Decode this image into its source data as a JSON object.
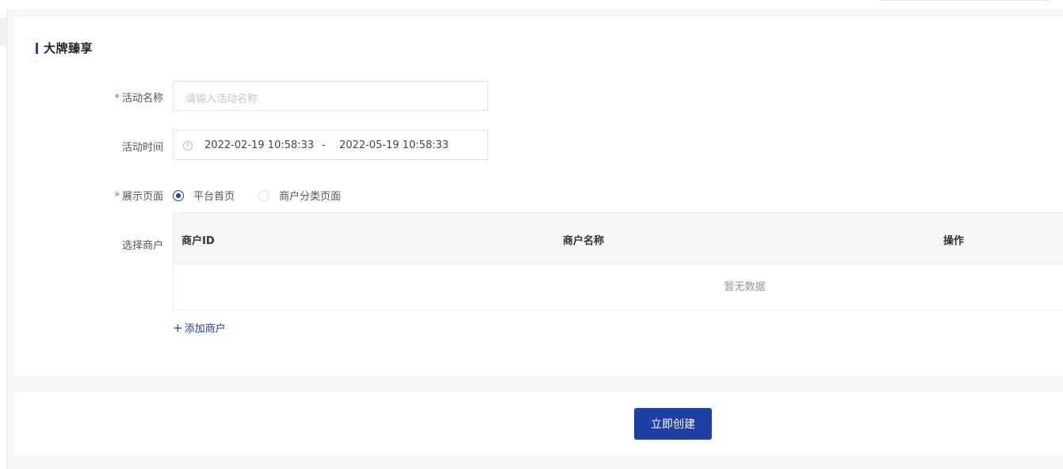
{
  "section": {
    "title": "大牌臻享"
  },
  "form": {
    "activity_name": {
      "label": "活动名称",
      "required": true,
      "placeholder": "请输入活动名称",
      "value": ""
    },
    "activity_time": {
      "label": "活动时间",
      "start": "2022-02-19 10:58:33",
      "separator": "-",
      "end": "2022-05-19 10:58:33"
    },
    "display_page": {
      "label": "展示页面",
      "required": true,
      "options": [
        {
          "label": "平台首页",
          "checked": true
        },
        {
          "label": "商户分类页面",
          "checked": false
        }
      ]
    },
    "merchants": {
      "label": "选择商户",
      "columns": [
        "商户ID",
        "商户名称",
        "操作"
      ],
      "empty_text": "暂无数据",
      "add_label": "添加商户"
    },
    "required_mark": "*"
  },
  "footer": {
    "submit_label": "立即创建"
  },
  "colors": {
    "primary": "#1e3fa6",
    "required": "#e5534b"
  }
}
